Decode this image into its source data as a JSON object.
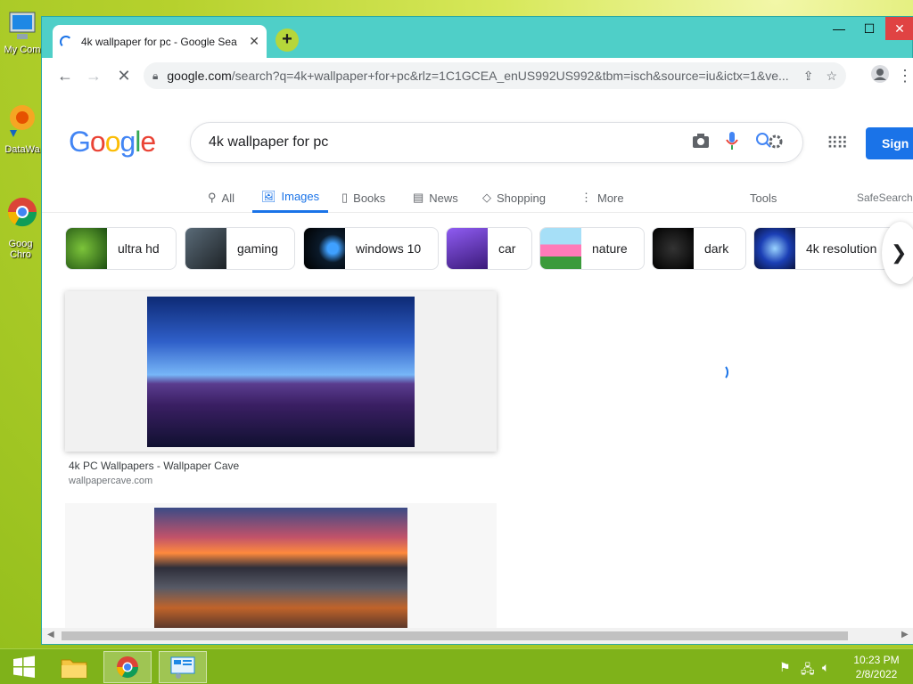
{
  "desktop": {
    "icons": [
      {
        "label": "My Com"
      },
      {
        "label": "DataWa"
      },
      {
        "label": "Goog Chro"
      }
    ]
  },
  "browser": {
    "tab_title": "4k wallpaper for pc - Google Sea",
    "url_host": "google.com",
    "url_rest": "/search?q=4k+wallpaper+for+pc&rlz=1C1GCEA_enUS992US992&tbm=isch&source=iu&ictx=1&ve..."
  },
  "page": {
    "logo": [
      "G",
      "o",
      "o",
      "g",
      "l",
      "e"
    ],
    "logo_colors": [
      "#4285F4",
      "#EA4335",
      "#FBBC05",
      "#4285F4",
      "#34A853",
      "#EA4335"
    ],
    "query": "4k wallpaper for pc",
    "signin_label": "Sign i",
    "tabs": [
      {
        "label": "All",
        "icon": "search-icon"
      },
      {
        "label": "Images",
        "icon": "image-icon"
      },
      {
        "label": "Books",
        "icon": "book-icon"
      },
      {
        "label": "News",
        "icon": "news-icon"
      },
      {
        "label": "Shopping",
        "icon": "tag-icon"
      },
      {
        "label": "More",
        "icon": "more-icon"
      }
    ],
    "tools_label": "Tools",
    "safesearch_label": "SafeSearch",
    "chips": [
      {
        "label": "ultra hd"
      },
      {
        "label": "gaming"
      },
      {
        "label": "windows 10"
      },
      {
        "label": "car"
      },
      {
        "label": "nature"
      },
      {
        "label": "dark"
      },
      {
        "label": "4k resolution"
      }
    ],
    "results": [
      {
        "title": "4k PC Wallpapers - Wallpaper Cave",
        "source": "wallpapercave.com"
      }
    ]
  },
  "taskbar": {
    "time": "10:23 PM",
    "date": "2/8/2022"
  }
}
